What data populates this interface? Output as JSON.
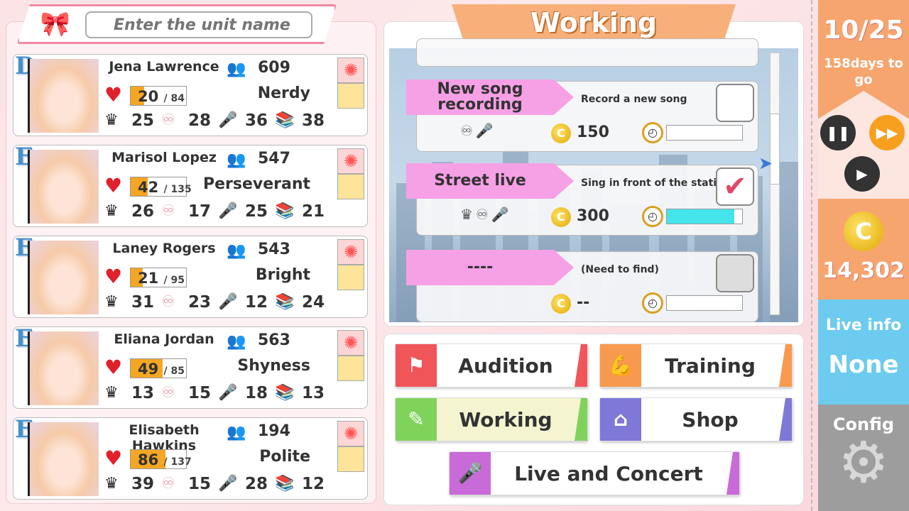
{
  "search": {
    "placeholder": "Enter the unit name"
  },
  "members": [
    {
      "rank": "D",
      "name": "Jena Lawrence",
      "fans": "609",
      "hp": "20",
      "hp_max": "/ 84",
      "hp_fill": 0.24,
      "trait": "Nerdy",
      "stats": [
        "25",
        "28",
        "36",
        "38"
      ]
    },
    {
      "rank": "E",
      "name": "Marisol Lopez",
      "fans": "547",
      "hp": "42",
      "hp_max": "/ 135",
      "hp_fill": 0.31,
      "trait": "Perseverant",
      "stats": [
        "26",
        "17",
        "25",
        "21"
      ]
    },
    {
      "rank": "E",
      "name": "Laney Rogers",
      "fans": "543",
      "hp": "21",
      "hp_max": "/ 95",
      "hp_fill": 0.22,
      "trait": "Bright",
      "stats": [
        "31",
        "23",
        "12",
        "24"
      ]
    },
    {
      "rank": "E",
      "name": "Eliana Jordan",
      "fans": "563",
      "hp": "49",
      "hp_max": "/ 85",
      "hp_fill": 0.58,
      "trait": "Shyness",
      "stats": [
        "13",
        "15",
        "18",
        "13"
      ]
    },
    {
      "rank": "E",
      "name": "Elisabeth Hawkins",
      "fans": "194",
      "hp": "86",
      "hp_max": "/ 137",
      "hp_fill": 0.63,
      "trait": "Polite",
      "stats": [
        "39",
        "15",
        "28",
        "12"
      ]
    }
  ],
  "working": {
    "title": "Working",
    "jobs": [
      {
        "name": "New song recording",
        "desc": "Record a new song",
        "cost": "150",
        "checked": false,
        "progress": 0
      },
      {
        "name": "Street live",
        "desc": "Sing in front of the station",
        "cost": "300",
        "checked": true,
        "progress": 0.9
      },
      {
        "name": "----",
        "desc": "(Need to find)",
        "cost": "--",
        "checked": false,
        "progress": 0
      }
    ]
  },
  "menu": {
    "audition": "Audition",
    "training": "Training",
    "working": "Working",
    "shop": "Shop",
    "live": "Live and Concert"
  },
  "status": {
    "date": "10/25",
    "days_left": "158days to go",
    "money": "14,302",
    "live_info_label": "Live info",
    "live_info_value": "None",
    "config": "Config"
  },
  "colors": {
    "audition": "#f0555a",
    "training": "#f79a4f",
    "working": "#7fd35b",
    "shop": "#7e78d8",
    "live": "#c86ad8",
    "fans": "#55b14a",
    "check": "#e04868"
  }
}
